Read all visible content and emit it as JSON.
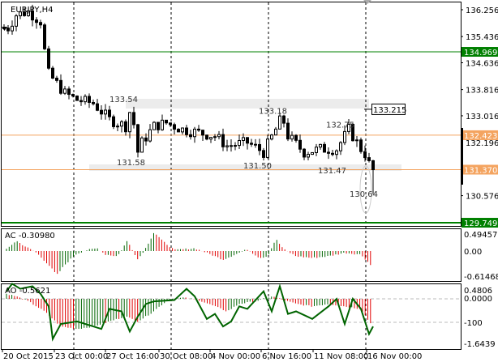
{
  "symbol_label": "EURJPY,H4",
  "colors": {
    "green_line": "#008000",
    "orange_line": "#f4a460",
    "bull": "#006400",
    "bear": "#e00000",
    "zone": "#ececec"
  },
  "price_axis": {
    "ticks": [
      "136.256",
      "135.436",
      "134.636",
      "133.816",
      "133.016",
      "132.196",
      "130.576"
    ],
    "tick_values": [
      136.256,
      135.436,
      134.636,
      133.816,
      133.016,
      132.196,
      130.576
    ],
    "range": [
      129.5,
      136.55
    ]
  },
  "levels": [
    {
      "label": "134.969",
      "value": 134.969,
      "color": "#008000"
    },
    {
      "label": "132.423",
      "value": 132.423,
      "color": "#f4a460"
    },
    {
      "label": "131.370",
      "value": 131.37,
      "color": "#f4a460"
    },
    {
      "label": "129.749",
      "value": 129.749,
      "color": "#008000"
    }
  ],
  "annotations": [
    {
      "text": "133.54",
      "bar": 28.2,
      "price": 133.54
    },
    {
      "text": "131.58",
      "bar": 30.0,
      "price": 131.6
    },
    {
      "text": "133.18",
      "bar": 65.0,
      "price": 133.18
    },
    {
      "text": "131.50",
      "bar": 61.2,
      "price": 131.5
    },
    {
      "text": "132.75",
      "bar": 81.6,
      "price": 132.75
    },
    {
      "text": "131.47",
      "bar": 79.6,
      "price": 131.36
    },
    {
      "text": "130.64",
      "bar": 87.4,
      "price": 130.64
    }
  ],
  "price_marker": {
    "text": "133.215",
    "value": 133.215
  },
  "candle_closes": [
    [
      1,
      135.7
    ],
    [
      3,
      136.1
    ],
    [
      6,
      136.2
    ],
    [
      9,
      135.9
    ],
    [
      10,
      135.0
    ],
    [
      11,
      134.3
    ],
    [
      13,
      134.0
    ],
    [
      15,
      133.7
    ],
    [
      18,
      133.5
    ],
    [
      22,
      133.4
    ],
    [
      26,
      132.9
    ],
    [
      30,
      132.7
    ],
    [
      31.6,
      133.4
    ],
    [
      32.6,
      131.8
    ],
    [
      34,
      132.2
    ],
    [
      37,
      132.7
    ],
    [
      40,
      132.8
    ],
    [
      44,
      132.6
    ],
    [
      48,
      132.5
    ],
    [
      52,
      132.4
    ],
    [
      55,
      132.1
    ],
    [
      60,
      132.2
    ],
    [
      64,
      131.9
    ],
    [
      67,
      132.6
    ],
    [
      68.6,
      133.0
    ],
    [
      70,
      132.4
    ],
    [
      74,
      131.9
    ],
    [
      78,
      132.0
    ],
    [
      82,
      132.0
    ],
    [
      85,
      132.6
    ],
    [
      88,
      132.0
    ],
    [
      89.4,
      131.8
    ],
    [
      90.4,
      131.37
    ]
  ],
  "ac": {
    "label": "AC -0.30980",
    "ticks": [
      "0.49457",
      "0.00",
      "-0.61468"
    ],
    "keys": [
      [
        0.6,
        0.05
      ],
      [
        3,
        0.3
      ],
      [
        5,
        0.15
      ],
      [
        8,
        -0.05
      ],
      [
        11,
        -0.4
      ],
      [
        13,
        -0.7
      ],
      [
        15,
        -0.4
      ],
      [
        17.6,
        -0.1
      ],
      [
        20,
        0.02
      ],
      [
        23,
        0.08
      ],
      [
        25,
        -0.1
      ],
      [
        28,
        -0.15
      ],
      [
        30.4,
        0.3
      ],
      [
        33,
        -0.25
      ],
      [
        35,
        0.1
      ],
      [
        37,
        0.55
      ],
      [
        39,
        0.3
      ],
      [
        42,
        0.03
      ],
      [
        47,
        0.08
      ],
      [
        50,
        -0.05
      ],
      [
        54,
        -0.25
      ],
      [
        57,
        -0.1
      ],
      [
        60,
        0.05
      ],
      [
        63,
        -0.2
      ],
      [
        65,
        -0.15
      ],
      [
        67,
        0.35
      ],
      [
        69,
        0.05
      ],
      [
        72,
        -0.15
      ],
      [
        76,
        -0.2
      ],
      [
        80,
        -0.15
      ],
      [
        84,
        -0.05
      ],
      [
        88,
        -0.1
      ],
      [
        90,
        -0.35
      ],
      [
        91,
        -0.5
      ]
    ]
  },
  "ao": {
    "label": "AO -0.5621",
    "ticks": [
      "0.4806",
      "0.0000",
      "-100",
      "-1.6439"
    ],
    "keys": [
      [
        0.6,
        0.2
      ],
      [
        3,
        0.1
      ],
      [
        6,
        -0.1
      ],
      [
        10,
        -0.5
      ],
      [
        14,
        -1.1
      ],
      [
        18,
        -1.2
      ],
      [
        22,
        -1.1
      ],
      [
        26,
        -0.9
      ],
      [
        30,
        -0.7
      ],
      [
        33,
        -0.9
      ],
      [
        36,
        -0.6
      ],
      [
        40,
        -0.1
      ],
      [
        44,
        0.05
      ],
      [
        48,
        -0.05
      ],
      [
        52,
        -0.3
      ],
      [
        55,
        -0.5
      ],
      [
        58,
        -0.2
      ],
      [
        62,
        -0.1
      ],
      [
        66,
        0.1
      ],
      [
        69,
        -0.05
      ],
      [
        72,
        -0.2
      ],
      [
        76,
        -0.3
      ],
      [
        80,
        -0.2
      ],
      [
        84,
        -0.3
      ],
      [
        88,
        -0.4
      ],
      [
        90,
        -0.9
      ],
      [
        91,
        -1.1
      ]
    ],
    "line": [
      [
        0.6,
        0.3
      ],
      [
        2,
        0.6
      ],
      [
        4,
        0.4
      ],
      [
        7,
        0.5
      ],
      [
        9,
        0.2
      ],
      [
        11,
        -0.3
      ],
      [
        12,
        -1.6
      ],
      [
        14,
        -1.0
      ],
      [
        18,
        -0.9
      ],
      [
        22,
        -1.1
      ],
      [
        24,
        -1.2
      ],
      [
        26,
        -0.4
      ],
      [
        29,
        -0.5
      ],
      [
        31,
        -1.3
      ],
      [
        33,
        -0.7
      ],
      [
        35,
        -0.2
      ],
      [
        37,
        -0.1
      ],
      [
        42,
        -0.05
      ],
      [
        45,
        0.4
      ],
      [
        47,
        0.1
      ],
      [
        50,
        -0.8
      ],
      [
        52,
        -0.6
      ],
      [
        54,
        -1.1
      ],
      [
        56,
        -0.9
      ],
      [
        58,
        -0.3
      ],
      [
        60,
        -0.4
      ],
      [
        64,
        0.3
      ],
      [
        66,
        -0.5
      ],
      [
        68,
        0.5
      ],
      [
        70,
        -0.6
      ],
      [
        72,
        -0.5
      ],
      [
        76,
        -0.8
      ],
      [
        80,
        -0.3
      ],
      [
        82,
        0.0
      ],
      [
        84,
        -1.0
      ],
      [
        86,
        0.0
      ],
      [
        88,
        -0.4
      ],
      [
        90,
        -1.4
      ],
      [
        91,
        -1.1
      ]
    ]
  },
  "time_axis": [
    "20 Oct 2015",
    "23 Oct 00:00",
    "27 Oct 16:00",
    "30 Oct 08:00",
    "4 Nov 00:00",
    "6 Nov 16:00",
    "11 Nov 08:00",
    "16 Nov 00:00"
  ]
}
